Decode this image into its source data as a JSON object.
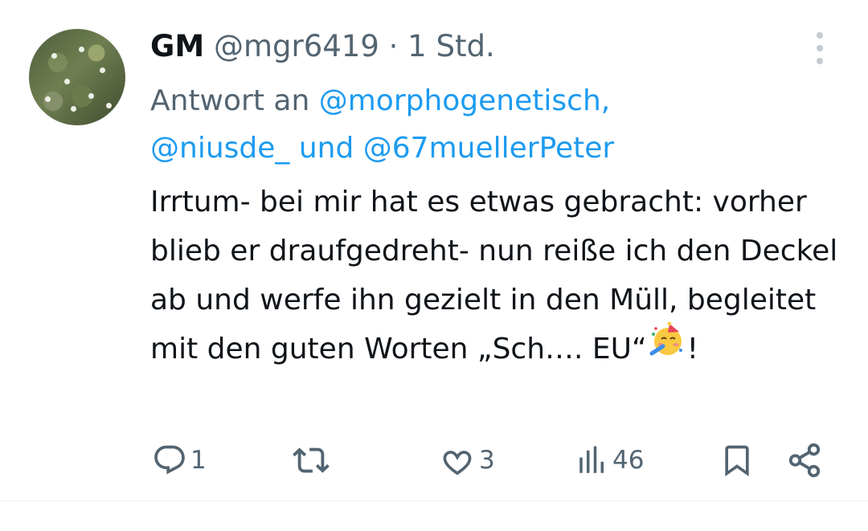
{
  "author": {
    "name": "GM",
    "handle": "@mgr6419",
    "separator": "·",
    "time": "1 Std."
  },
  "reply_to": {
    "prefix": "Antwort an",
    "mention_1": "@morphogenetisch,",
    "mention_2": "@niusde_",
    "conjunction": "und",
    "mention_3": "@67muellerPeter"
  },
  "tweet": {
    "text_main": "Irrtum- bei mir hat es etwas gebracht: vorher blieb er draufgedreht- nun reiße ich den Deckel ab und werfe ihn gezielt in den Müll, begleitet mit den guten Worten „Sch…. EU“",
    "emoji": "partying-face-emoji",
    "text_end": "!"
  },
  "actions": {
    "replies": "1",
    "reposts": "",
    "likes": "3",
    "views": "46"
  },
  "colors": {
    "accent": "#1d9bf0",
    "text": "#0f1419",
    "secondary": "#536471"
  }
}
